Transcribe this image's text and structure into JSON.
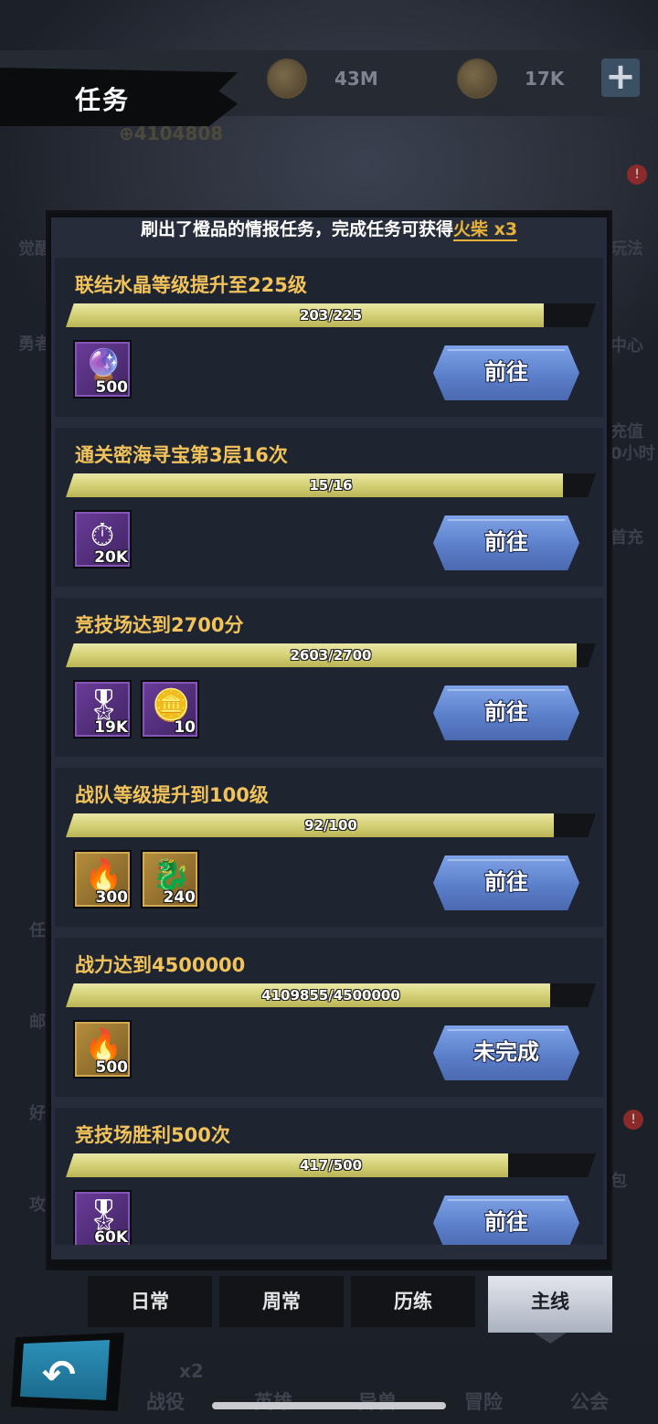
{
  "screen": {
    "title": "任务"
  },
  "resources": {
    "currency1": "43M",
    "currency2": "17K",
    "power": "4104808"
  },
  "background_side_labels": {
    "left": [
      "觉醒",
      "勇者",
      "任",
      "邮",
      "好",
      "攻"
    ],
    "right": [
      "玩法",
      "中心",
      "充值",
      "0小时",
      "首充",
      "包"
    ]
  },
  "notice": {
    "prefix": "刷出了橙品的情报任务，完成任务可获得",
    "highlight": "火柴 x3"
  },
  "tasks": [
    {
      "name": "联结水晶等级提升至225级",
      "progress_text": "203/225",
      "progress": 0.902,
      "rewards": [
        {
          "icon": "crystal-orb-icon",
          "qty": "500",
          "rarity": "purple"
        }
      ],
      "button": "前往"
    },
    {
      "name": "通关密海寻宝第3层16次",
      "progress_text": "15/16",
      "progress": 0.9375,
      "rewards": [
        {
          "icon": "pocket-watch-icon",
          "qty": "20K",
          "rarity": "purple"
        }
      ],
      "button": "前往"
    },
    {
      "name": "竞技场达到2700分",
      "progress_text": "2603/2700",
      "progress": 0.964,
      "rewards": [
        {
          "icon": "star-medal-icon",
          "qty": "19K",
          "rarity": "purple"
        },
        {
          "icon": "sword-coin-icon",
          "qty": "10",
          "rarity": "purple"
        }
      ],
      "button": "前往"
    },
    {
      "name": "战队等级提升到100级",
      "progress_text": "92/100",
      "progress": 0.92,
      "rewards": [
        {
          "icon": "flame-key-icon",
          "qty": "300",
          "rarity": "gold"
        },
        {
          "icon": "dragon-emblem-icon",
          "qty": "240",
          "rarity": "gold"
        }
      ],
      "button": "前往"
    },
    {
      "name": "战力达到4500000",
      "progress_text": "4109855/4500000",
      "progress": 0.913,
      "rewards": [
        {
          "icon": "flame-key-icon",
          "qty": "500",
          "rarity": "gold"
        }
      ],
      "button": "未完成"
    },
    {
      "name": "竞技场胜利500次",
      "progress_text": "417/500",
      "progress": 0.834,
      "rewards": [
        {
          "icon": "star-medal-icon",
          "qty": "60K",
          "rarity": "purple"
        }
      ],
      "button": "前往"
    }
  ],
  "tabs": [
    {
      "label": "日常",
      "active": false
    },
    {
      "label": "周常",
      "active": false
    },
    {
      "label": "历练",
      "active": false
    },
    {
      "label": "主线",
      "active": true
    }
  ],
  "bottom_nav": [
    "战役",
    "英雄",
    "异兽",
    "冒险",
    "公会"
  ],
  "bottom_badge": "x2",
  "colors": {
    "task_title": "#f1c35a",
    "progress_fill": "#d7d37a",
    "button_blue": "#5c7fca",
    "notice_highlight": "#e8b23a"
  }
}
